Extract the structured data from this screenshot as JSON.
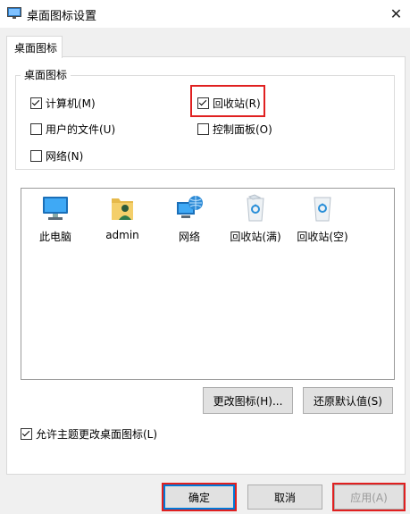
{
  "window": {
    "title": "桌面图标设置",
    "close_glyph": "✕"
  },
  "tabs": [
    {
      "label": "桌面图标"
    }
  ],
  "group": {
    "title": "桌面图标",
    "checkboxes": [
      {
        "label": "计算机(M)",
        "checked": true
      },
      {
        "label": "回收站(R)",
        "checked": true
      },
      {
        "label": "用户的文件(U)",
        "checked": false
      },
      {
        "label": "控制面板(O)",
        "checked": false
      },
      {
        "label": "网络(N)",
        "checked": false
      }
    ]
  },
  "icons": [
    {
      "label": "此电脑",
      "icon": "computer-icon"
    },
    {
      "label": "admin",
      "icon": "user-folder-icon"
    },
    {
      "label": "网络",
      "icon": "network-icon"
    },
    {
      "label": "回收站(满)",
      "icon": "recycle-bin-full-icon"
    },
    {
      "label": "回收站(空)",
      "icon": "recycle-bin-empty-icon"
    }
  ],
  "buttons": {
    "change_icon": "更改图标(H)...",
    "restore_default": "还原默认值(S)",
    "ok": "确定",
    "cancel": "取消",
    "apply": "应用(A)"
  },
  "allow_themes": {
    "label": "允许主题更改桌面图标(L)",
    "checked": true
  },
  "colors": {
    "highlight": "#e02020",
    "accent": "#0078d7"
  }
}
